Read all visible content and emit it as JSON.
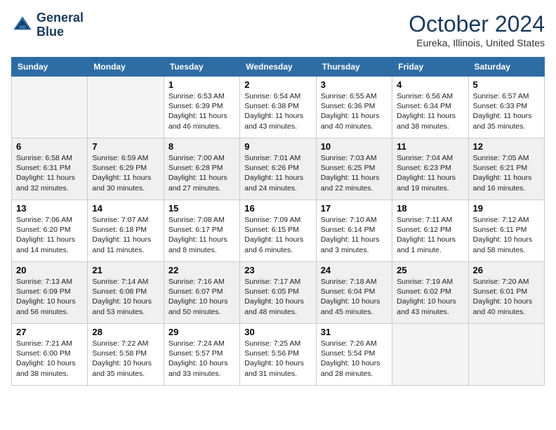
{
  "header": {
    "logo_line1": "General",
    "logo_line2": "Blue",
    "month": "October 2024",
    "location": "Eureka, Illinois, United States"
  },
  "days_of_week": [
    "Sunday",
    "Monday",
    "Tuesday",
    "Wednesday",
    "Thursday",
    "Friday",
    "Saturday"
  ],
  "weeks": [
    [
      {
        "day": "",
        "info": ""
      },
      {
        "day": "",
        "info": ""
      },
      {
        "day": "1",
        "info": "Sunrise: 6:53 AM\nSunset: 6:39 PM\nDaylight: 11 hours and 46 minutes."
      },
      {
        "day": "2",
        "info": "Sunrise: 6:54 AM\nSunset: 6:38 PM\nDaylight: 11 hours and 43 minutes."
      },
      {
        "day": "3",
        "info": "Sunrise: 6:55 AM\nSunset: 6:36 PM\nDaylight: 11 hours and 40 minutes."
      },
      {
        "day": "4",
        "info": "Sunrise: 6:56 AM\nSunset: 6:34 PM\nDaylight: 11 hours and 38 minutes."
      },
      {
        "day": "5",
        "info": "Sunrise: 6:57 AM\nSunset: 6:33 PM\nDaylight: 11 hours and 35 minutes."
      }
    ],
    [
      {
        "day": "6",
        "info": "Sunrise: 6:58 AM\nSunset: 6:31 PM\nDaylight: 11 hours and 32 minutes."
      },
      {
        "day": "7",
        "info": "Sunrise: 6:59 AM\nSunset: 6:29 PM\nDaylight: 11 hours and 30 minutes."
      },
      {
        "day": "8",
        "info": "Sunrise: 7:00 AM\nSunset: 6:28 PM\nDaylight: 11 hours and 27 minutes."
      },
      {
        "day": "9",
        "info": "Sunrise: 7:01 AM\nSunset: 6:26 PM\nDaylight: 11 hours and 24 minutes."
      },
      {
        "day": "10",
        "info": "Sunrise: 7:03 AM\nSunset: 6:25 PM\nDaylight: 11 hours and 22 minutes."
      },
      {
        "day": "11",
        "info": "Sunrise: 7:04 AM\nSunset: 6:23 PM\nDaylight: 11 hours and 19 minutes."
      },
      {
        "day": "12",
        "info": "Sunrise: 7:05 AM\nSunset: 6:21 PM\nDaylight: 11 hours and 16 minutes."
      }
    ],
    [
      {
        "day": "13",
        "info": "Sunrise: 7:06 AM\nSunset: 6:20 PM\nDaylight: 11 hours and 14 minutes."
      },
      {
        "day": "14",
        "info": "Sunrise: 7:07 AM\nSunset: 6:18 PM\nDaylight: 11 hours and 11 minutes."
      },
      {
        "day": "15",
        "info": "Sunrise: 7:08 AM\nSunset: 6:17 PM\nDaylight: 11 hours and 8 minutes."
      },
      {
        "day": "16",
        "info": "Sunrise: 7:09 AM\nSunset: 6:15 PM\nDaylight: 11 hours and 6 minutes."
      },
      {
        "day": "17",
        "info": "Sunrise: 7:10 AM\nSunset: 6:14 PM\nDaylight: 11 hours and 3 minutes."
      },
      {
        "day": "18",
        "info": "Sunrise: 7:11 AM\nSunset: 6:12 PM\nDaylight: 11 hours and 1 minute."
      },
      {
        "day": "19",
        "info": "Sunrise: 7:12 AM\nSunset: 6:11 PM\nDaylight: 10 hours and 58 minutes."
      }
    ],
    [
      {
        "day": "20",
        "info": "Sunrise: 7:13 AM\nSunset: 6:09 PM\nDaylight: 10 hours and 56 minutes."
      },
      {
        "day": "21",
        "info": "Sunrise: 7:14 AM\nSunset: 6:08 PM\nDaylight: 10 hours and 53 minutes."
      },
      {
        "day": "22",
        "info": "Sunrise: 7:16 AM\nSunset: 6:07 PM\nDaylight: 10 hours and 50 minutes."
      },
      {
        "day": "23",
        "info": "Sunrise: 7:17 AM\nSunset: 6:05 PM\nDaylight: 10 hours and 48 minutes."
      },
      {
        "day": "24",
        "info": "Sunrise: 7:18 AM\nSunset: 6:04 PM\nDaylight: 10 hours and 45 minutes."
      },
      {
        "day": "25",
        "info": "Sunrise: 7:19 AM\nSunset: 6:02 PM\nDaylight: 10 hours and 43 minutes."
      },
      {
        "day": "26",
        "info": "Sunrise: 7:20 AM\nSunset: 6:01 PM\nDaylight: 10 hours and 40 minutes."
      }
    ],
    [
      {
        "day": "27",
        "info": "Sunrise: 7:21 AM\nSunset: 6:00 PM\nDaylight: 10 hours and 38 minutes."
      },
      {
        "day": "28",
        "info": "Sunrise: 7:22 AM\nSunset: 5:58 PM\nDaylight: 10 hours and 35 minutes."
      },
      {
        "day": "29",
        "info": "Sunrise: 7:24 AM\nSunset: 5:57 PM\nDaylight: 10 hours and 33 minutes."
      },
      {
        "day": "30",
        "info": "Sunrise: 7:25 AM\nSunset: 5:56 PM\nDaylight: 10 hours and 31 minutes."
      },
      {
        "day": "31",
        "info": "Sunrise: 7:26 AM\nSunset: 5:54 PM\nDaylight: 10 hours and 28 minutes."
      },
      {
        "day": "",
        "info": ""
      },
      {
        "day": "",
        "info": ""
      }
    ]
  ]
}
